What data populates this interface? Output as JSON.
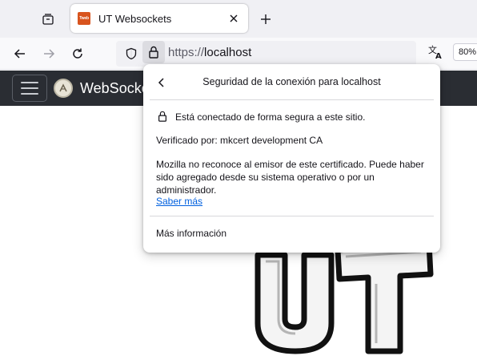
{
  "browser": {
    "tab": {
      "title": "UT Websockets",
      "favicon_text": "Tweb"
    },
    "url": {
      "scheme": "https://",
      "host": "localhost"
    },
    "zoom": "80%"
  },
  "page": {
    "brand": "WebSockets"
  },
  "popup": {
    "title": "Seguridad de la conexión para localhost",
    "secure_text": "Está conectado de forma segura a este sitio.",
    "verified_by": "Verificado por: mkcert development CA",
    "warning": "Mozilla no reconoce al emisor de este certificado. Puede haber sido agregado desde su sistema operativo o por un administrador.",
    "learn_more": "Saber más",
    "more_info": "Más información"
  },
  "colors": {
    "accent_link": "#0060df",
    "site_header": "#2a2d33",
    "tab_strip": "#f0f0f4"
  },
  "icons": [
    "tab-list-icon",
    "close-icon",
    "plus-icon",
    "back-arrow-icon",
    "forward-arrow-icon",
    "reload-icon",
    "shield-icon",
    "lock-icon",
    "translate-icon",
    "chevron-left-icon"
  ]
}
